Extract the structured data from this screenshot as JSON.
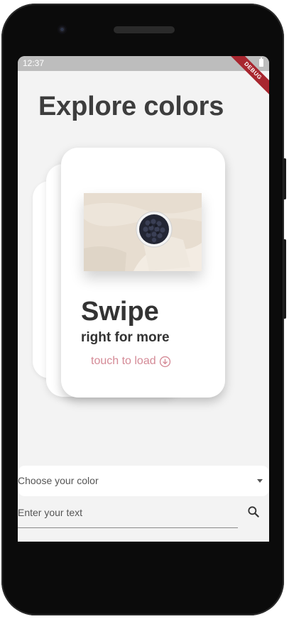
{
  "status_bar": {
    "time": "12:37",
    "debug_banner": "DEBUG"
  },
  "header": {
    "title": "Explore colors"
  },
  "card": {
    "image_icon": "blueberries-bowl-photo",
    "headline": "Swipe",
    "subline": "right for more",
    "action_label": "touch to load",
    "action_icon": "download-circle-icon",
    "accent_color": "#d48a96"
  },
  "color_dropdown": {
    "selected_label": "Choose your color"
  },
  "text_input": {
    "placeholder": "Enter your text",
    "value": ""
  },
  "search": {
    "icon": "search-icon"
  }
}
